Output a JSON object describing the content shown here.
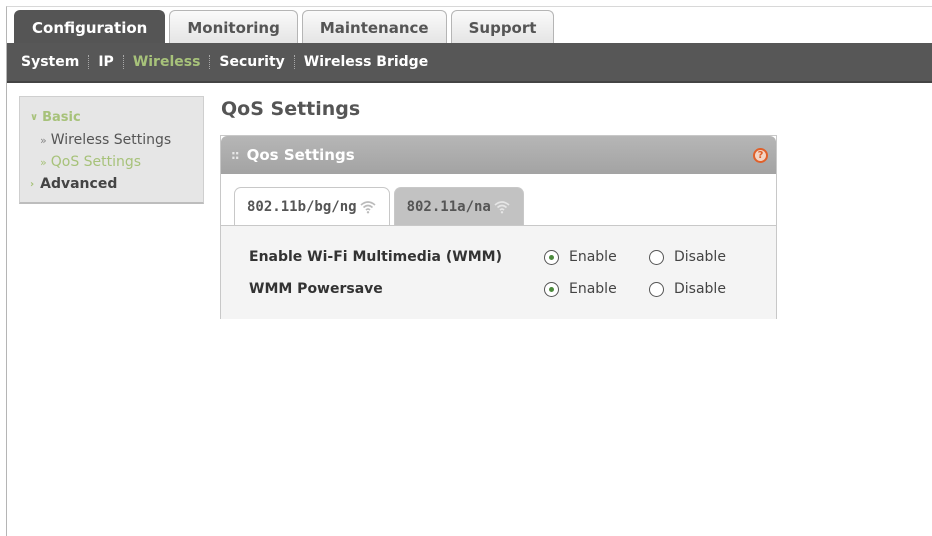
{
  "top_tabs": [
    {
      "label": "Configuration",
      "active": true
    },
    {
      "label": "Monitoring",
      "active": false
    },
    {
      "label": "Maintenance",
      "active": false
    },
    {
      "label": "Support",
      "active": false
    }
  ],
  "subnav": [
    {
      "label": "System",
      "active": false
    },
    {
      "label": "IP",
      "active": false
    },
    {
      "label": "Wireless",
      "active": true
    },
    {
      "label": "Security",
      "active": false
    },
    {
      "label": "Wireless Bridge",
      "active": false
    }
  ],
  "left_menu": {
    "basic_label": "Basic",
    "basic_items": [
      {
        "label": "Wireless Settings",
        "active": false
      },
      {
        "label": "QoS Settings",
        "active": true
      }
    ],
    "advanced_label": "Advanced"
  },
  "page_title": "QoS Settings",
  "panel": {
    "title": "Qos Settings",
    "help_symbol": "?",
    "band_tabs": [
      {
        "label": "802.11b/bg/ng",
        "active": true
      },
      {
        "label": "802.11a/na",
        "active": false
      }
    ],
    "rows": [
      {
        "label": "Enable Wi-Fi Multimedia (WMM)",
        "enable_label": "Enable",
        "disable_label": "Disable",
        "selected": "enable"
      },
      {
        "label": "WMM Powersave",
        "enable_label": "Enable",
        "disable_label": "Disable",
        "selected": "enable"
      }
    ]
  },
  "colors": {
    "accent_green": "#a7c27a",
    "nav_dark": "#575757",
    "help_orange": "#e0602a"
  },
  "icons": {
    "grip": "grip-dots-icon",
    "help": "help-icon",
    "wifi": "wifi-icon",
    "expand": "chevron-down-icon",
    "collapse": "chevron-right-icon",
    "sub_item": "double-chevron-icon"
  }
}
